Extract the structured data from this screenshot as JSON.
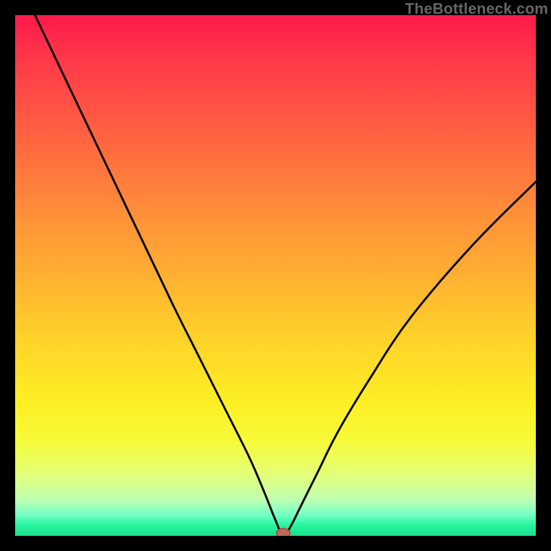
{
  "watermark": "TheBottleneck.com",
  "colors": {
    "gradient_top": "#ff1a4a",
    "gradient_bottom": "#17e18c",
    "curve": "#000000",
    "marker_fill": "#c16a5a",
    "marker_stroke": "#9e4d3e"
  },
  "chart_data": {
    "type": "line",
    "title": "",
    "xlabel": "",
    "ylabel": "",
    "xlim": [
      0,
      100
    ],
    "ylim": [
      0,
      100
    ],
    "grid": false,
    "legend": false,
    "series": [
      {
        "name": "bottleneck-curve",
        "x": [
          0,
          10,
          20,
          30,
          35,
          40,
          45,
          48,
          50,
          51.5,
          53,
          55,
          58,
          62,
          68,
          76,
          88,
          100
        ],
        "y": [
          108,
          87,
          66,
          45,
          35,
          25,
          15,
          8,
          3,
          0,
          2,
          6,
          12,
          20,
          30,
          42,
          56,
          68
        ]
      }
    ],
    "marker": {
      "x": 51.5,
      "y": 0.5
    },
    "notes": "V-shaped curve reaching minimum near x≈51.5; background is a vertical red→green gradient indicating bottleneck severity."
  }
}
